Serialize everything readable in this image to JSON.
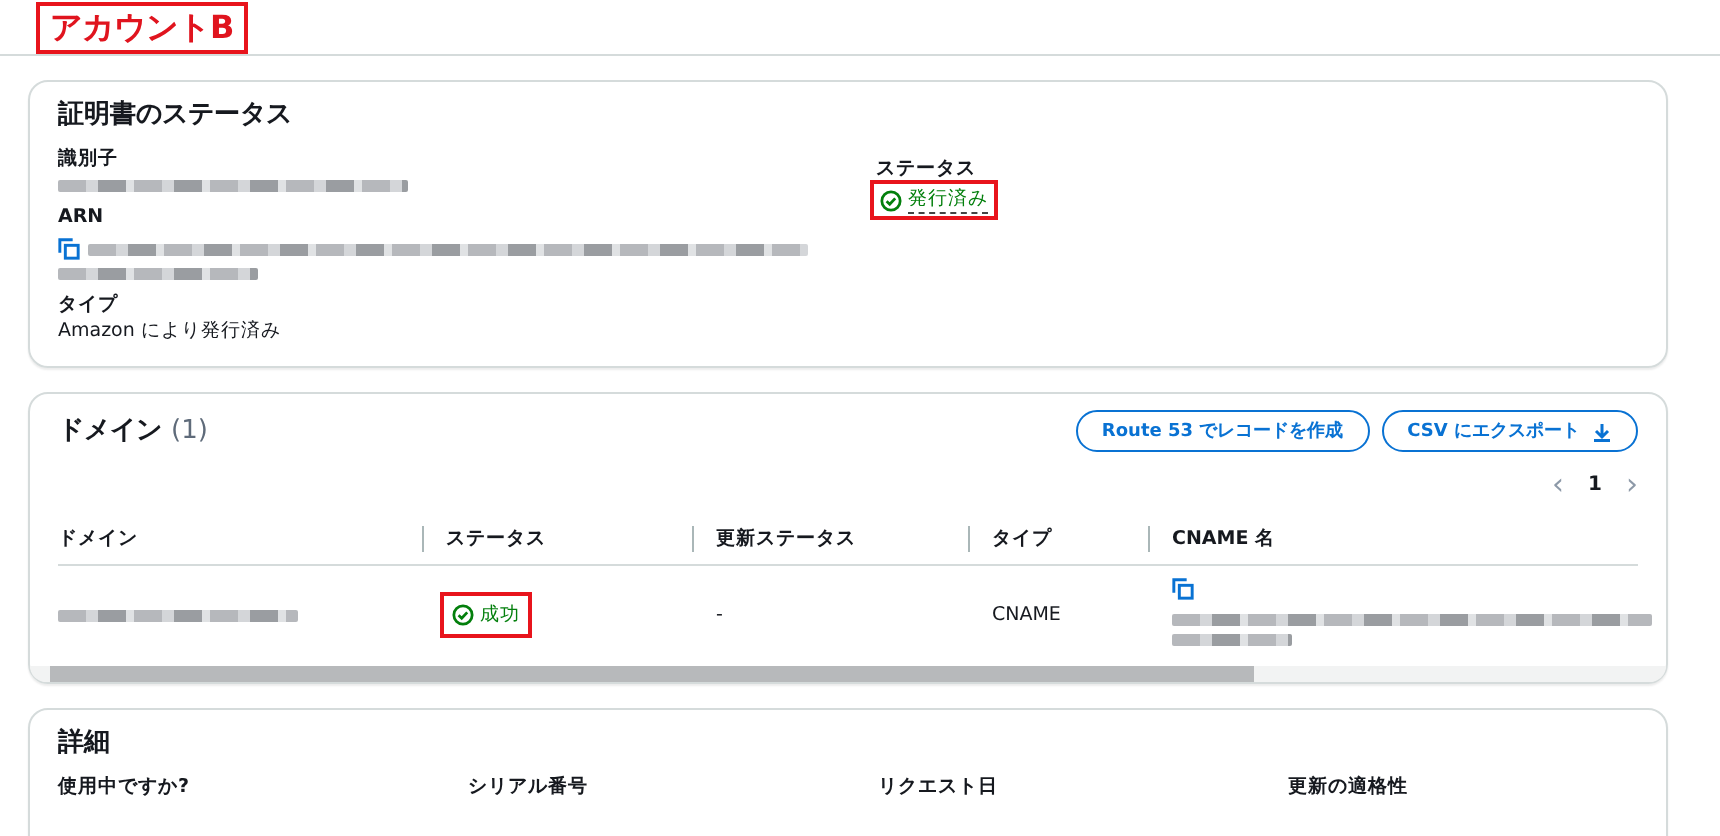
{
  "page_title": {
    "text": "アカウントB",
    "highlighted": true
  },
  "certificate_status": {
    "heading": "証明書のステータス",
    "fields": [
      {
        "label": "識別子",
        "kind": "redacted"
      },
      {
        "label": "ARN",
        "kind": "redacted_copy"
      },
      {
        "label": "タイプ",
        "kind": "text",
        "value": "Amazon により発行済み"
      }
    ],
    "status": {
      "label": "ステータス",
      "value": "発行済み",
      "highlighted": true
    }
  },
  "domains": {
    "heading": "ドメイン",
    "count": "(1)",
    "buttons": [
      {
        "label": "Route 53 でレコードを作成",
        "kind": "plain"
      },
      {
        "label": "CSV にエクスポート",
        "kind": "download"
      }
    ],
    "pagination": {
      "prev": "‹",
      "page": "1",
      "next": "›"
    },
    "table": {
      "columns": [
        "ドメイン",
        "ステータス",
        "更新ステータス",
        "タイプ",
        "CNAME 名"
      ],
      "rows": [
        {
          "status": "成功",
          "status_highlighted": true,
          "renewal_status": "-",
          "type": "CNAME"
        }
      ]
    }
  },
  "details": {
    "heading": "詳細",
    "labels": [
      "使用中ですか?",
      "シリアル番号",
      "リクエスト日",
      "更新の適格性"
    ]
  }
}
